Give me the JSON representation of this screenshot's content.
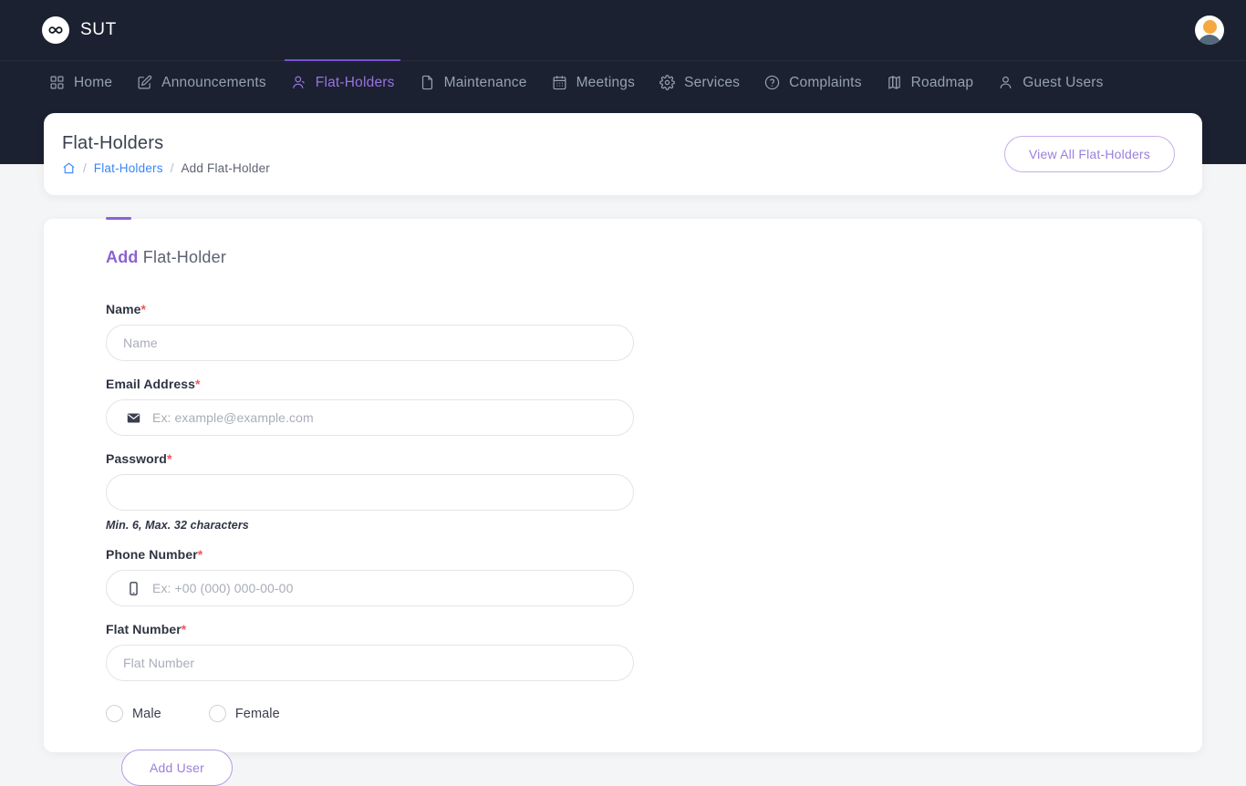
{
  "brand": {
    "name": "SUT",
    "logo_icon": "infinity-icon",
    "avatar_icon": "user-avatar"
  },
  "nav": {
    "items": [
      {
        "label": "Home",
        "icon": "grid-icon",
        "active": false
      },
      {
        "label": "Announcements",
        "icon": "edit-square-icon",
        "active": false
      },
      {
        "label": "Flat-Holders",
        "icon": "user-group-icon",
        "active": true
      },
      {
        "label": "Maintenance",
        "icon": "document-icon",
        "active": false
      },
      {
        "label": "Meetings",
        "icon": "calendar-icon",
        "active": false
      },
      {
        "label": "Services",
        "icon": "gear-icon",
        "active": false
      },
      {
        "label": "Complaints",
        "icon": "question-icon",
        "active": false
      },
      {
        "label": "Roadmap",
        "icon": "map-icon",
        "active": false
      },
      {
        "label": "Guest Users",
        "icon": "user-icon",
        "active": false
      }
    ]
  },
  "header": {
    "title": "Flat-Holders",
    "breadcrumb": {
      "home_icon": "home-icon",
      "separator": "/",
      "link": "Flat-Holders",
      "current": "Add Flat-Holder"
    },
    "view_all_button": "View All Flat-Holders"
  },
  "form": {
    "heading_accent": "Add",
    "heading_rest": " Flat-Holder",
    "required_marker": "*",
    "fields": [
      {
        "label": "Name",
        "placeholder": "Name",
        "value": "",
        "icon": null,
        "required": true
      },
      {
        "label": "Email Address",
        "placeholder": "Ex: example@example.com",
        "value": "",
        "icon": "envelope-icon",
        "required": true
      },
      {
        "label": "Password",
        "placeholder": "",
        "value": "",
        "icon": null,
        "required": true,
        "hint": "Min. 6, Max. 32 characters"
      },
      {
        "label": "Phone Number",
        "placeholder": "Ex: +00 (000) 000-00-00",
        "value": "",
        "icon": "phone-icon",
        "required": true
      },
      {
        "label": "Flat Number",
        "placeholder": "Flat Number",
        "value": "",
        "icon": null,
        "required": true
      }
    ],
    "gender": {
      "options": [
        {
          "label": "Male",
          "selected": false
        },
        {
          "label": "Female",
          "selected": false
        }
      ]
    },
    "submit_button": "Add User"
  },
  "colors": {
    "navbar_bg": "#1b2130",
    "page_bg": "#f4f5f6",
    "accent_purple": "#8a63d2",
    "link_blue": "#3a86f7",
    "required_red": "#f2565a",
    "avatar_head": "#f5a840",
    "avatar_body": "#54697b"
  }
}
